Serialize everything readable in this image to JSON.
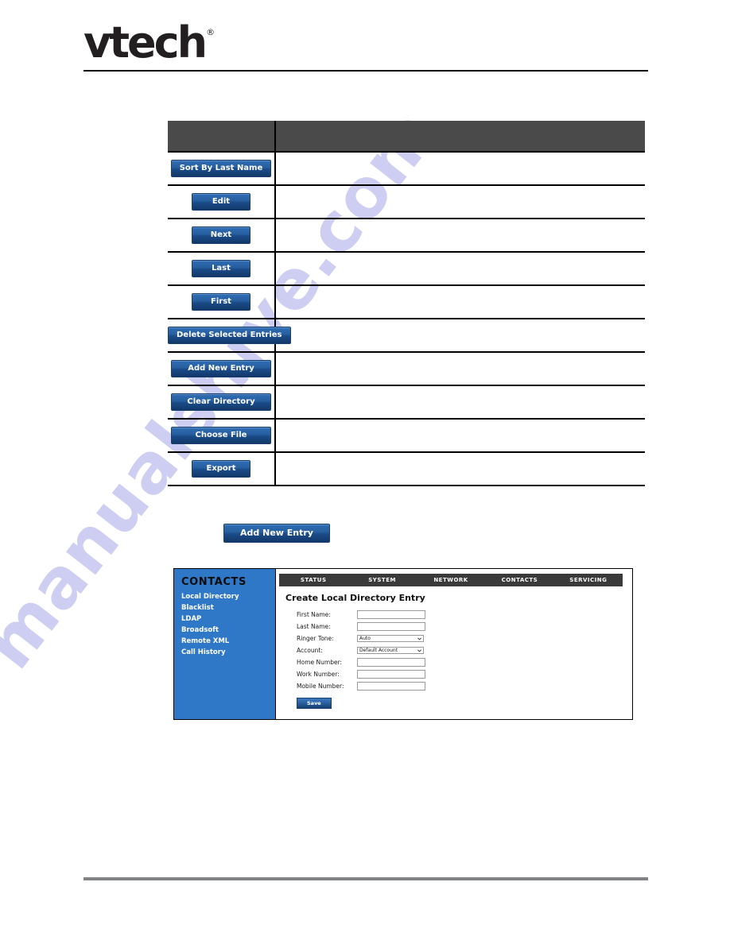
{
  "brand": {
    "logo_text": "vtech",
    "registered_mark": "®"
  },
  "watermark": {
    "text": "manualshive.com",
    "color": "#ccccf2"
  },
  "button_table": {
    "header": {
      "col1": "",
      "col2": ""
    },
    "rows": [
      {
        "button_label": "Sort By Last Name",
        "description": ""
      },
      {
        "button_label": "Edit",
        "description": ""
      },
      {
        "button_label": "Next",
        "description": ""
      },
      {
        "button_label": "Last",
        "description": ""
      },
      {
        "button_label": "First",
        "description": ""
      },
      {
        "button_label": "Delete Selected Entries",
        "description": ""
      },
      {
        "button_label": "Add New Entry",
        "description": ""
      },
      {
        "button_label": "Clear Directory",
        "description": ""
      },
      {
        "button_label": "Choose File",
        "description": ""
      },
      {
        "button_label": "Export",
        "description": ""
      }
    ]
  },
  "standalone_button": {
    "label": "Add New Entry"
  },
  "web_ui": {
    "sidebar": {
      "title": "CONTACTS",
      "items": [
        {
          "label": "Local Directory"
        },
        {
          "label": "Blacklist"
        },
        {
          "label": "LDAP"
        },
        {
          "label": "Broadsoft"
        },
        {
          "label": "Remote XML"
        },
        {
          "label": "Call History"
        }
      ]
    },
    "topnav": {
      "tabs": [
        {
          "label": "STATUS"
        },
        {
          "label": "SYSTEM"
        },
        {
          "label": "NETWORK"
        },
        {
          "label": "CONTACTS"
        },
        {
          "label": "SERVICING"
        }
      ]
    },
    "heading": "Create Local Directory Entry",
    "form": {
      "fields": [
        {
          "label": "First Name:",
          "type": "text",
          "value": ""
        },
        {
          "label": "Last Name:",
          "type": "text",
          "value": ""
        },
        {
          "label": "Ringer Tone:",
          "type": "select",
          "value": "Auto"
        },
        {
          "label": "Account:",
          "type": "select",
          "value": "Default Account"
        },
        {
          "label": "Home Number:",
          "type": "text",
          "value": ""
        },
        {
          "label": "Work Number:",
          "type": "text",
          "value": ""
        },
        {
          "label": "Mobile Number:",
          "type": "text",
          "value": ""
        }
      ],
      "save_label": "Save"
    }
  },
  "colors": {
    "button_blue": "#2a5f9f",
    "header_gray": "#4a4a4a",
    "sidebar_blue": "#2f78c8",
    "nav_dark": "#3a3a3a",
    "footer_gray": "#808284"
  }
}
